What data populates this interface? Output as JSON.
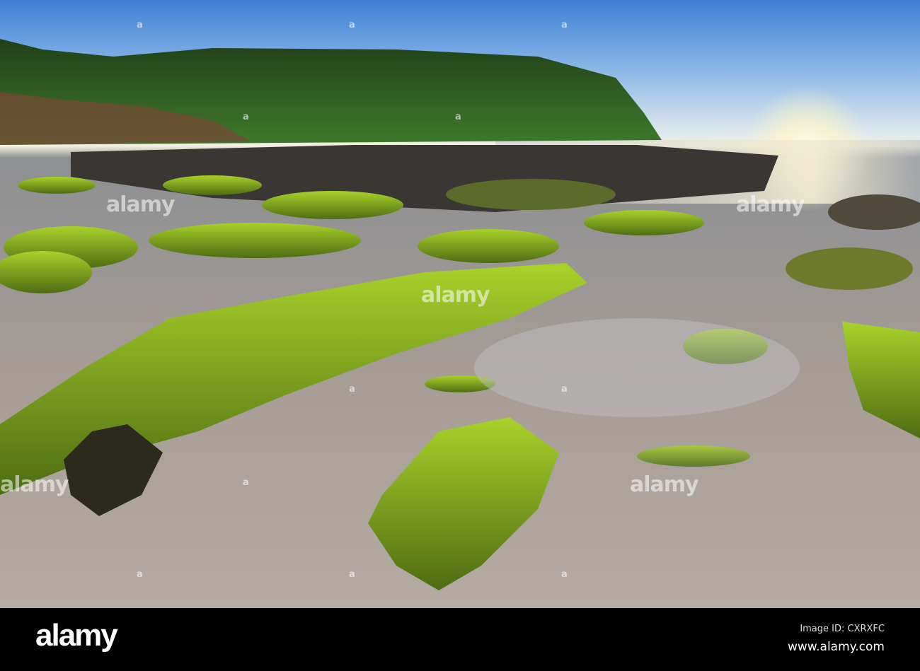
{
  "watermark": {
    "text": "alamy",
    "symbol": "a"
  },
  "footer": {
    "logo": "alamy",
    "image_id": "Image ID: CXRXFC",
    "url": "www.alamy.com"
  },
  "colors": {
    "moss": "#8fc21e",
    "hill": "#2f5a24",
    "sand": "#a59c96",
    "sky": "#3f7fd4"
  }
}
